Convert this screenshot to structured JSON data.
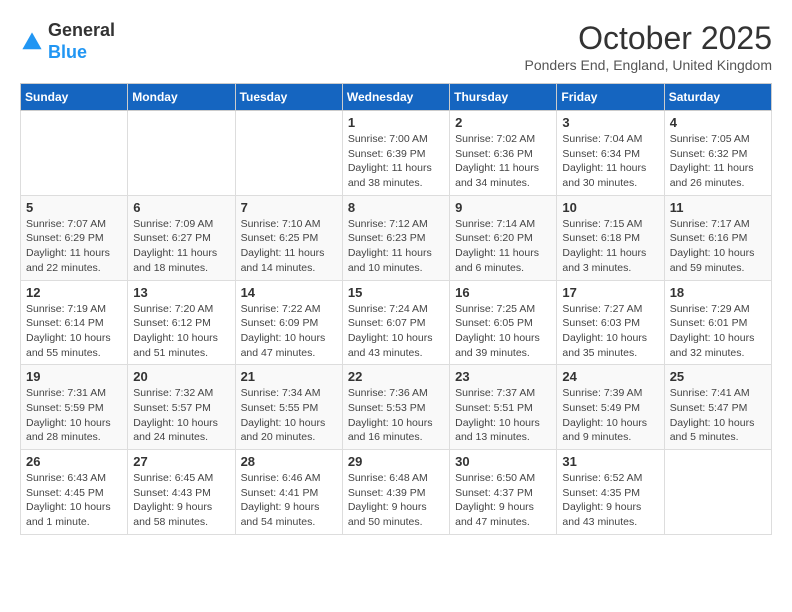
{
  "header": {
    "logo": {
      "general": "General",
      "blue": "Blue"
    },
    "title": "October 2025",
    "subtitle": "Ponders End, England, United Kingdom"
  },
  "days_of_week": [
    "Sunday",
    "Monday",
    "Tuesday",
    "Wednesday",
    "Thursday",
    "Friday",
    "Saturday"
  ],
  "weeks": [
    [
      {
        "day": "",
        "info": ""
      },
      {
        "day": "",
        "info": ""
      },
      {
        "day": "",
        "info": ""
      },
      {
        "day": "1",
        "info": "Sunrise: 7:00 AM\nSunset: 6:39 PM\nDaylight: 11 hours\nand 38 minutes."
      },
      {
        "day": "2",
        "info": "Sunrise: 7:02 AM\nSunset: 6:36 PM\nDaylight: 11 hours\nand 34 minutes."
      },
      {
        "day": "3",
        "info": "Sunrise: 7:04 AM\nSunset: 6:34 PM\nDaylight: 11 hours\nand 30 minutes."
      },
      {
        "day": "4",
        "info": "Sunrise: 7:05 AM\nSunset: 6:32 PM\nDaylight: 11 hours\nand 26 minutes."
      }
    ],
    [
      {
        "day": "5",
        "info": "Sunrise: 7:07 AM\nSunset: 6:29 PM\nDaylight: 11 hours\nand 22 minutes."
      },
      {
        "day": "6",
        "info": "Sunrise: 7:09 AM\nSunset: 6:27 PM\nDaylight: 11 hours\nand 18 minutes."
      },
      {
        "day": "7",
        "info": "Sunrise: 7:10 AM\nSunset: 6:25 PM\nDaylight: 11 hours\nand 14 minutes."
      },
      {
        "day": "8",
        "info": "Sunrise: 7:12 AM\nSunset: 6:23 PM\nDaylight: 11 hours\nand 10 minutes."
      },
      {
        "day": "9",
        "info": "Sunrise: 7:14 AM\nSunset: 6:20 PM\nDaylight: 11 hours\nand 6 minutes."
      },
      {
        "day": "10",
        "info": "Sunrise: 7:15 AM\nSunset: 6:18 PM\nDaylight: 11 hours\nand 3 minutes."
      },
      {
        "day": "11",
        "info": "Sunrise: 7:17 AM\nSunset: 6:16 PM\nDaylight: 10 hours\nand 59 minutes."
      }
    ],
    [
      {
        "day": "12",
        "info": "Sunrise: 7:19 AM\nSunset: 6:14 PM\nDaylight: 10 hours\nand 55 minutes."
      },
      {
        "day": "13",
        "info": "Sunrise: 7:20 AM\nSunset: 6:12 PM\nDaylight: 10 hours\nand 51 minutes."
      },
      {
        "day": "14",
        "info": "Sunrise: 7:22 AM\nSunset: 6:09 PM\nDaylight: 10 hours\nand 47 minutes."
      },
      {
        "day": "15",
        "info": "Sunrise: 7:24 AM\nSunset: 6:07 PM\nDaylight: 10 hours\nand 43 minutes."
      },
      {
        "day": "16",
        "info": "Sunrise: 7:25 AM\nSunset: 6:05 PM\nDaylight: 10 hours\nand 39 minutes."
      },
      {
        "day": "17",
        "info": "Sunrise: 7:27 AM\nSunset: 6:03 PM\nDaylight: 10 hours\nand 35 minutes."
      },
      {
        "day": "18",
        "info": "Sunrise: 7:29 AM\nSunset: 6:01 PM\nDaylight: 10 hours\nand 32 minutes."
      }
    ],
    [
      {
        "day": "19",
        "info": "Sunrise: 7:31 AM\nSunset: 5:59 PM\nDaylight: 10 hours\nand 28 minutes."
      },
      {
        "day": "20",
        "info": "Sunrise: 7:32 AM\nSunset: 5:57 PM\nDaylight: 10 hours\nand 24 minutes."
      },
      {
        "day": "21",
        "info": "Sunrise: 7:34 AM\nSunset: 5:55 PM\nDaylight: 10 hours\nand 20 minutes."
      },
      {
        "day": "22",
        "info": "Sunrise: 7:36 AM\nSunset: 5:53 PM\nDaylight: 10 hours\nand 16 minutes."
      },
      {
        "day": "23",
        "info": "Sunrise: 7:37 AM\nSunset: 5:51 PM\nDaylight: 10 hours\nand 13 minutes."
      },
      {
        "day": "24",
        "info": "Sunrise: 7:39 AM\nSunset: 5:49 PM\nDaylight: 10 hours\nand 9 minutes."
      },
      {
        "day": "25",
        "info": "Sunrise: 7:41 AM\nSunset: 5:47 PM\nDaylight: 10 hours\nand 5 minutes."
      }
    ],
    [
      {
        "day": "26",
        "info": "Sunrise: 6:43 AM\nSunset: 4:45 PM\nDaylight: 10 hours\nand 1 minute."
      },
      {
        "day": "27",
        "info": "Sunrise: 6:45 AM\nSunset: 4:43 PM\nDaylight: 9 hours\nand 58 minutes."
      },
      {
        "day": "28",
        "info": "Sunrise: 6:46 AM\nSunset: 4:41 PM\nDaylight: 9 hours\nand 54 minutes."
      },
      {
        "day": "29",
        "info": "Sunrise: 6:48 AM\nSunset: 4:39 PM\nDaylight: 9 hours\nand 50 minutes."
      },
      {
        "day": "30",
        "info": "Sunrise: 6:50 AM\nSunset: 4:37 PM\nDaylight: 9 hours\nand 47 minutes."
      },
      {
        "day": "31",
        "info": "Sunrise: 6:52 AM\nSunset: 4:35 PM\nDaylight: 9 hours\nand 43 minutes."
      },
      {
        "day": "",
        "info": ""
      }
    ]
  ]
}
